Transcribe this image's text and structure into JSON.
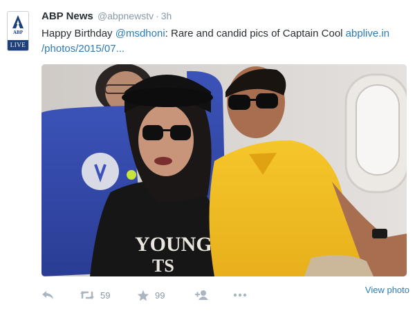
{
  "tweet": {
    "author_name": "ABP News",
    "handle": "@abpnewstv",
    "separator": "·",
    "time": "3h",
    "text_prefix": "Happy Birthday ",
    "mention": "@msdhoni",
    "text_body": ": Rare and candid pics of Captain Cool ",
    "link_line1": "abplive.in",
    "link_line2": "/photos/2015/07...",
    "avatar": {
      "abbr": "ABP",
      "badge": "LIVE"
    },
    "photo": {
      "shirt_text": "YOUNG",
      "shirt_text2": "TS"
    }
  },
  "actions": {
    "retweet_count": "59",
    "favorite_count": "99",
    "view_photo": "View photo",
    "icons": [
      "reply-icon",
      "retweet-icon",
      "star-icon",
      "follow-icon",
      "more-icon"
    ]
  },
  "colors": {
    "link": "#2b7bb9",
    "muted": "#8899a6",
    "icon": "#a9b6c2",
    "brand": "#1d3f7a"
  }
}
